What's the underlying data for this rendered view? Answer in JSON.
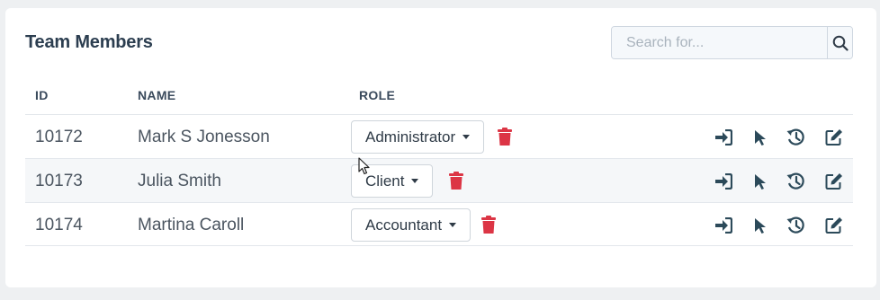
{
  "header": {
    "title": "Team Members",
    "search_placeholder": "Search for..."
  },
  "columns": {
    "id": "ID",
    "name": "NAME",
    "role": "ROLE"
  },
  "rows": [
    {
      "id": "10172",
      "name": "Mark S Jonesson",
      "role": "Administrator"
    },
    {
      "id": "10173",
      "name": "Julia Smith",
      "role": "Client"
    },
    {
      "id": "10174",
      "name": "Martina Caroll",
      "role": "Accountant"
    }
  ],
  "colors": {
    "delete": "#dc3545",
    "action_icon": "#2c4a5a",
    "title": "#2c3e50"
  },
  "row_actions": [
    "sign-in-icon",
    "pointer-icon",
    "history-icon",
    "edit-icon"
  ]
}
